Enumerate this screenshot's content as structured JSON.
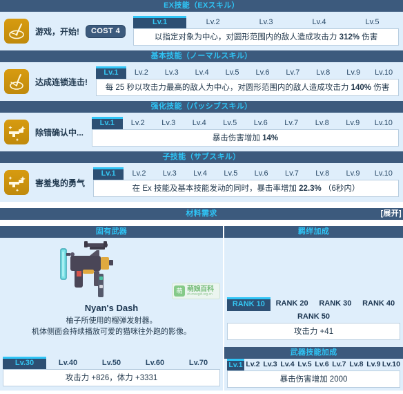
{
  "colors": {
    "header_bar": "#3c5a7d",
    "header_text": "#2fc4f5",
    "panel_bg": "#dfeefb",
    "active_tab_bg": "#2d4f73",
    "active_tab_text": "#35c6f2",
    "accent_top": "#2fc4f5",
    "icon_gold": "#d79b10"
  },
  "sections": {
    "ex": {
      "title": "EX技能（EXスキル）",
      "skill_name": "游戏，开始!",
      "cost_label": "COST 4",
      "icon": "ex-skill-icon",
      "levels": [
        "Lv.1",
        "Lv.2",
        "Lv.3",
        "Lv.4",
        "Lv.5"
      ],
      "active_level": 0,
      "description": "以指定对象为中心，对圆形范围内的敌人造成攻击力 312% 伤害",
      "description_plain": "以指定对象为中心，对圆形范围内的敌人造成攻击力",
      "description_value": "312%",
      "description_tail": "伤害"
    },
    "normal": {
      "title": "基本技能（ノーマルスキル）",
      "skill_name": "达成连锁连击!",
      "icon": "normal-skill-icon",
      "levels": [
        "Lv.1",
        "Lv.2",
        "Lv.3",
        "Lv.4",
        "Lv.5",
        "Lv.6",
        "Lv.7",
        "Lv.8",
        "Lv.9",
        "Lv.10"
      ],
      "active_level": 0,
      "description": "每 25 秒以攻击力最高的敌人为中心，对圆形范围内的敌人造成攻击力 140% 伤害",
      "description_plain": "每 25 秒以攻击力最高的敌人为中心，对圆形范围内的敌人造成攻击力",
      "description_value": "140%",
      "description_tail": "伤害"
    },
    "passive": {
      "title": "强化技能（パッシブスキル）",
      "skill_name": "除错确认中...",
      "icon": "passive-skill-icon",
      "levels": [
        "Lv.1",
        "Lv.2",
        "Lv.3",
        "Lv.4",
        "Lv.5",
        "Lv.6",
        "Lv.7",
        "Lv.8",
        "Lv.9",
        "Lv.10"
      ],
      "active_level": 0,
      "description": "暴击伤害增加 14%",
      "description_plain": "暴击伤害增加",
      "description_value": "14%",
      "description_tail": ""
    },
    "sub": {
      "title": "子技能（サブスキル）",
      "skill_name": "害羞鬼的勇气",
      "icon": "sub-skill-icon",
      "levels": [
        "Lv.1",
        "Lv.2",
        "Lv.3",
        "Lv.4",
        "Lv.5",
        "Lv.6",
        "Lv.7",
        "Lv.8",
        "Lv.9",
        "Lv.10"
      ],
      "active_level": 0,
      "description": "在 Ex 技能及基本技能发动的同时，暴击率增加 22.3%（6秒内）",
      "description_plain": "在 Ex 技能及基本技能发动的同时，暴击率增加",
      "description_value": "22.3%",
      "description_tail": "（6秒内）"
    }
  },
  "material": {
    "title": "材料需求",
    "expand_label": "[展开]"
  },
  "weapon": {
    "panel_title": "固有武器",
    "art_icon": "grenade-launcher-sprite",
    "name": "Nyan's Dash",
    "desc_line1": "柚子所使用的榴弹发射器。",
    "desc_line2": "机体侧面会持续播放可爱的猫咪往外跑的影像。",
    "levels": [
      "Lv.30",
      "Lv.40",
      "Lv.50",
      "Lv.60",
      "Lv.70"
    ],
    "active_level": 0,
    "stats": "攻击力 +826，体力 +3331"
  },
  "watermark": {
    "badge": "萌",
    "title": "萌娘百科",
    "url": "zh.moegirl.org.cn"
  },
  "bond": {
    "panel_title": "羁绊加成",
    "ranks_row1": [
      "RANK 10",
      "RANK 20",
      "RANK 30",
      "RANK 40"
    ],
    "ranks_row2": "RANK 50",
    "active_rank": 0,
    "stats": "攻击力 +41"
  },
  "weapon_skill": {
    "panel_title": "武器技能加成",
    "levels": [
      "Lv.1",
      "Lv.2",
      "Lv.3",
      "Lv.4",
      "Lv.5",
      "Lv.6",
      "Lv.7",
      "Lv.8",
      "Lv.9",
      "Lv.10"
    ],
    "active_level": 0,
    "description": "暴击伤害增加 2000"
  }
}
